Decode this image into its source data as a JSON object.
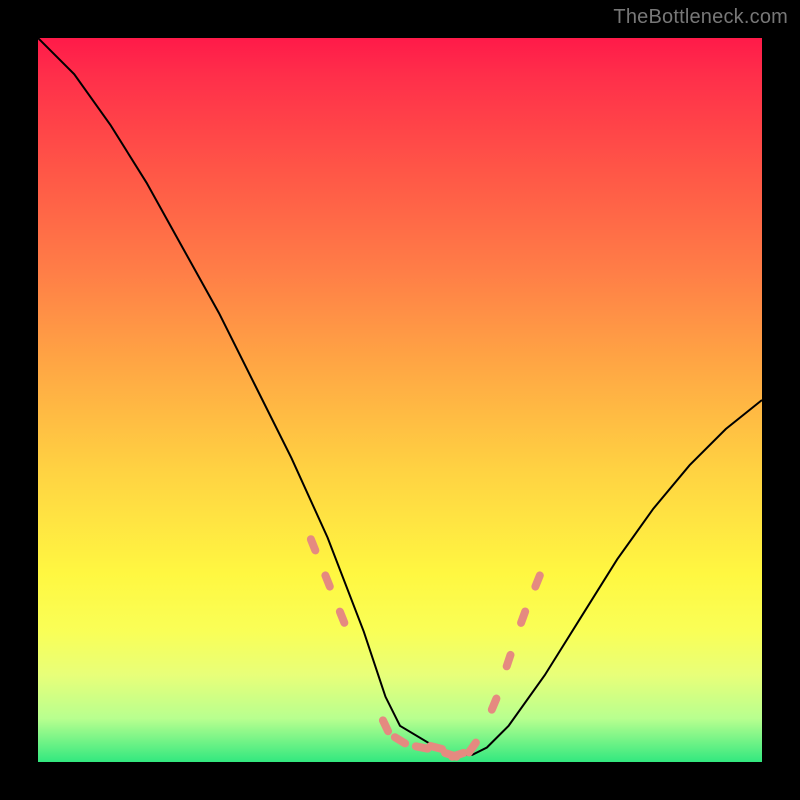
{
  "watermark": "TheBottleneck.com",
  "chart_data": {
    "type": "line",
    "title": "",
    "xlabel": "",
    "ylabel": "",
    "xlim": [
      0,
      100
    ],
    "ylim": [
      0,
      100
    ],
    "series": [
      {
        "name": "bottleneck-curve",
        "x": [
          0,
          5,
          10,
          15,
          20,
          25,
          30,
          35,
          40,
          45,
          48,
          50,
          55,
          58,
          60,
          62,
          65,
          70,
          75,
          80,
          85,
          90,
          95,
          100
        ],
        "values": [
          100,
          95,
          88,
          80,
          71,
          62,
          52,
          42,
          31,
          18,
          9,
          5,
          2,
          1,
          1,
          2,
          5,
          12,
          20,
          28,
          35,
          41,
          46,
          50
        ]
      }
    ],
    "markers": {
      "name": "highlight-dashes",
      "x": [
        38,
        40,
        42,
        48,
        50,
        53,
        55,
        57,
        58,
        60,
        63,
        65,
        67,
        69
      ],
      "values": [
        30,
        25,
        20,
        5,
        3,
        2,
        2,
        1,
        1,
        2,
        8,
        14,
        20,
        25
      ]
    },
    "background_gradient": {
      "top": "#ff1a49",
      "middle": "#ffd342",
      "bottom": "#32e87f"
    }
  }
}
